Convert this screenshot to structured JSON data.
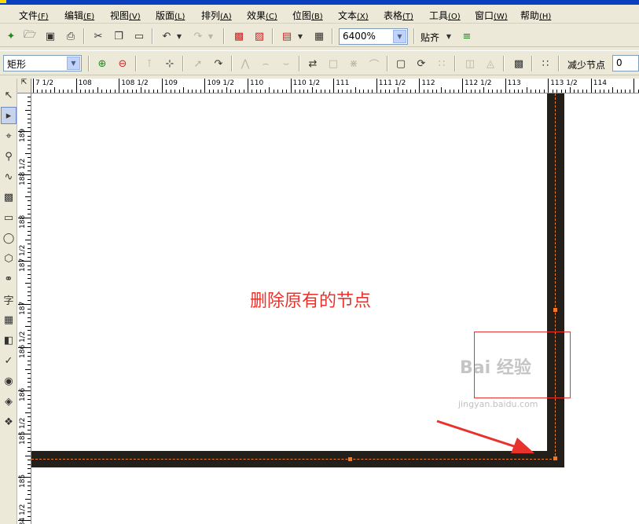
{
  "menubar": {
    "items": [
      {
        "label": "文件",
        "key": "(F)"
      },
      {
        "label": "编辑",
        "key": "(E)"
      },
      {
        "label": "视图",
        "key": "(V)"
      },
      {
        "label": "版面",
        "key": "(L)"
      },
      {
        "label": "排列",
        "key": "(A)"
      },
      {
        "label": "效果",
        "key": "(C)"
      },
      {
        "label": "位图",
        "key": "(B)"
      },
      {
        "label": "文本",
        "key": "(X)"
      },
      {
        "label": "表格",
        "key": "(T)"
      },
      {
        "label": "工具",
        "key": "(O)"
      },
      {
        "label": "窗口",
        "key": "(W)"
      },
      {
        "label": "帮助",
        "key": "(H)"
      }
    ]
  },
  "standard_toolbar": {
    "zoom_value": "6400%",
    "snap_label": "贴齐"
  },
  "property_bar": {
    "object_type": "矩形",
    "reduce_nodes_label": "减少节点",
    "reduce_nodes_value": "0"
  },
  "ruler": {
    "horizontal_labels": [
      "7 1/2",
      "108",
      "108 1/2",
      "109",
      "109 1/2",
      "110",
      "110 1/2",
      "111",
      "111 1/2",
      "112",
      "112 1/2",
      "113",
      "113 1/2",
      "114"
    ],
    "vertical_labels": [
      "189",
      "188 1/2",
      "188",
      "187 1/2",
      "187",
      "186 1/2",
      "186",
      "185 1/2",
      "185",
      "184 1/2"
    ]
  },
  "annotation": {
    "text": "删除原有的节点",
    "color": "#e8332d"
  },
  "watermark": {
    "logo_text": "Bai 经验",
    "url": "jingyan.baidu.com"
  },
  "colors": {
    "shape_fill": "#231f1b",
    "node_color": "#f07a2a",
    "annotation_red": "#e8332d"
  }
}
